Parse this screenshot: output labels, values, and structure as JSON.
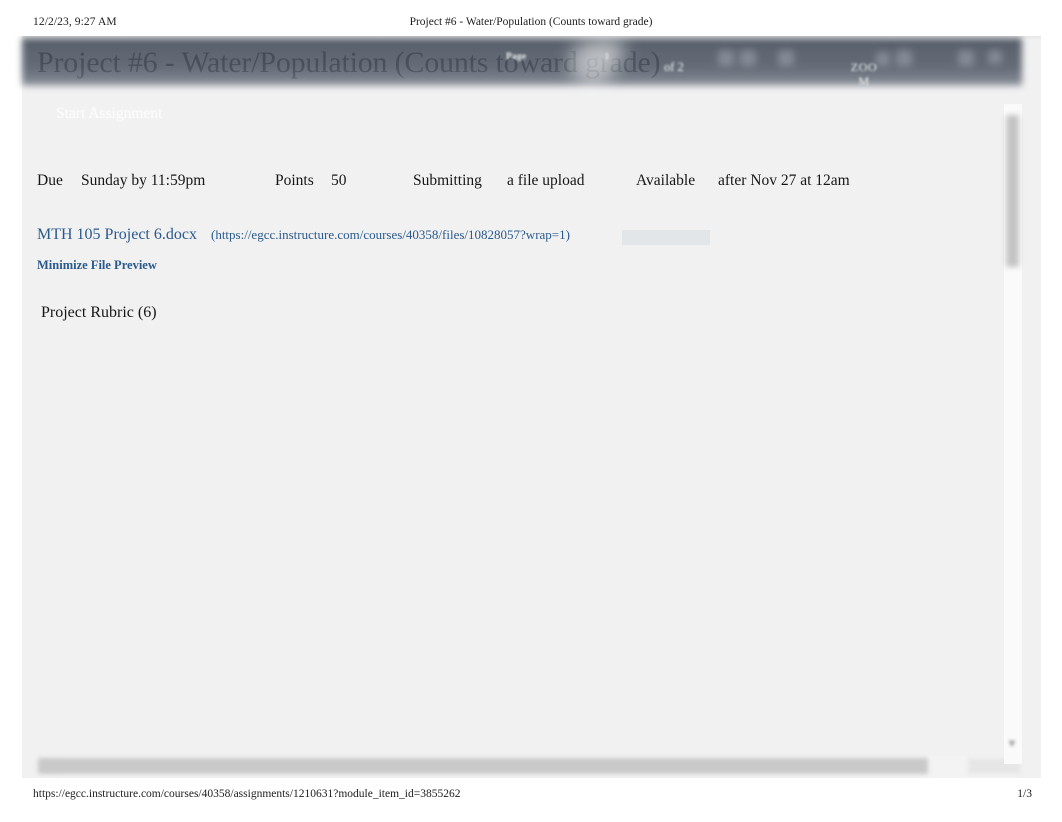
{
  "print_header": {
    "date": "12/2/23, 9:27 AM",
    "title": "Project #6 - Water/Population (Counts toward grade)"
  },
  "print_footer": {
    "url": "https://egcc.instructure.com/courses/40358/assignments/1210631?module_item_id=3855262",
    "page_indicator": "1/3"
  },
  "assignment": {
    "title": "Project #6 - Water/Population (Counts toward grade)",
    "start_button_label": "Start Assignment",
    "meta": {
      "due_label": "Due",
      "due_value": "Sunday by 11:59pm",
      "points_label": "Points",
      "points_value": "50",
      "submitting_label": "Submitting",
      "submitting_value": "a file upload",
      "available_label": "Available",
      "available_value": "after Nov 27 at 12am"
    },
    "file": {
      "name": "MTH 105  Project   6.docx",
      "url": "(https://egcc.instructure.com/courses/40358/files/10828057?wrap=1)"
    },
    "minimize_preview_label": "Minimize File Preview",
    "rubric_title": "Project Rubric (6)"
  },
  "viewer_toolbar": {
    "page_label": "Page",
    "page_value": "1",
    "page_of": "of 2",
    "zoom_label_line1": "ZOO",
    "zoom_label_line2": "M",
    "icons": [
      "rotate-left-icon",
      "rotate-right-icon",
      "fit-page-icon",
      "zoom-out-icon",
      "zoom-in-icon",
      "download-icon",
      "print-icon"
    ]
  },
  "scroll": {
    "vertical_thumb": "vertical-scrollbar-thumb",
    "horizontal_thumb": "horizontal-scrollbar-thumb",
    "arrow_glyph": "▼"
  },
  "colors": {
    "toolbar_dark": "#4b5360",
    "link_blue": "#2a5a8c",
    "page_bg": "#f1f1f1",
    "text": "#161616"
  }
}
